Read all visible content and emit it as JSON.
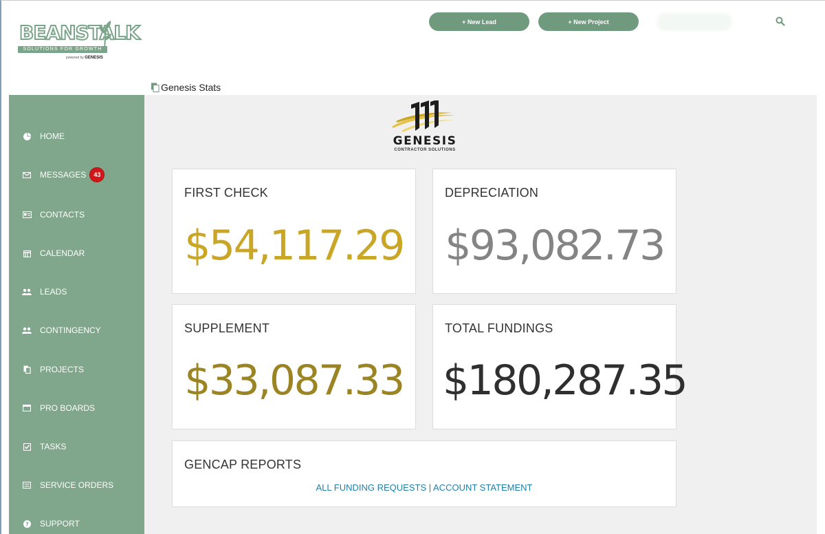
{
  "brand": {
    "name": "BEANSTALK",
    "tagline": "SOLUTIONS FOR GROWTH",
    "powered_by": "powered by",
    "powered_brand": "GENESIS",
    "accent_color": "#80a68b"
  },
  "header": {
    "new_lead_label": "+ New Lead",
    "new_project_label": "+ New Project"
  },
  "breadcrumb": {
    "title": "Genesis Stats"
  },
  "sidebar": {
    "items": [
      {
        "label": "HOME",
        "icon": "pie-chart-icon"
      },
      {
        "label": "MESSAGES",
        "icon": "envelope-icon",
        "badge": "43"
      },
      {
        "label": "CONTACTS",
        "icon": "id-card-icon"
      },
      {
        "label": "CALENDAR",
        "icon": "calendar-icon"
      },
      {
        "label": "LEADS",
        "icon": "users-icon"
      },
      {
        "label": "CONTINGENCY",
        "icon": "users-icon"
      },
      {
        "label": "PROJECTS",
        "icon": "copy-icon"
      },
      {
        "label": "PRO BOARDS",
        "icon": "window-icon"
      },
      {
        "label": "TASKS",
        "icon": "checkbox-icon"
      },
      {
        "label": "SERVICE ORDERS",
        "icon": "list-icon"
      },
      {
        "label": "SUPPORT",
        "icon": "question-icon"
      }
    ]
  },
  "genesis": {
    "name": "GENESIS",
    "subtitle": "CONTRACTOR SOLUTIONS"
  },
  "stats": {
    "first_check": {
      "title": "FIRST CHECK",
      "value": "$54,117.29",
      "color": "#c9a626"
    },
    "depreciation": {
      "title": "DEPRECIATION",
      "value": "$93,082.73",
      "color": "#848484"
    },
    "supplement": {
      "title": "SUPPLEMENT",
      "value": "$33,087.33",
      "color": "#9b8423"
    },
    "total_fundings": {
      "title": "TOTAL FUNDINGS",
      "value": "$180,287.35",
      "color": "#2f2f2f"
    }
  },
  "reports": {
    "title": "GENCAP REPORTS",
    "link_all": "ALL FUNDING REQUESTS",
    "separator": " | ",
    "link_statement": "ACCOUNT STATEMENT"
  }
}
